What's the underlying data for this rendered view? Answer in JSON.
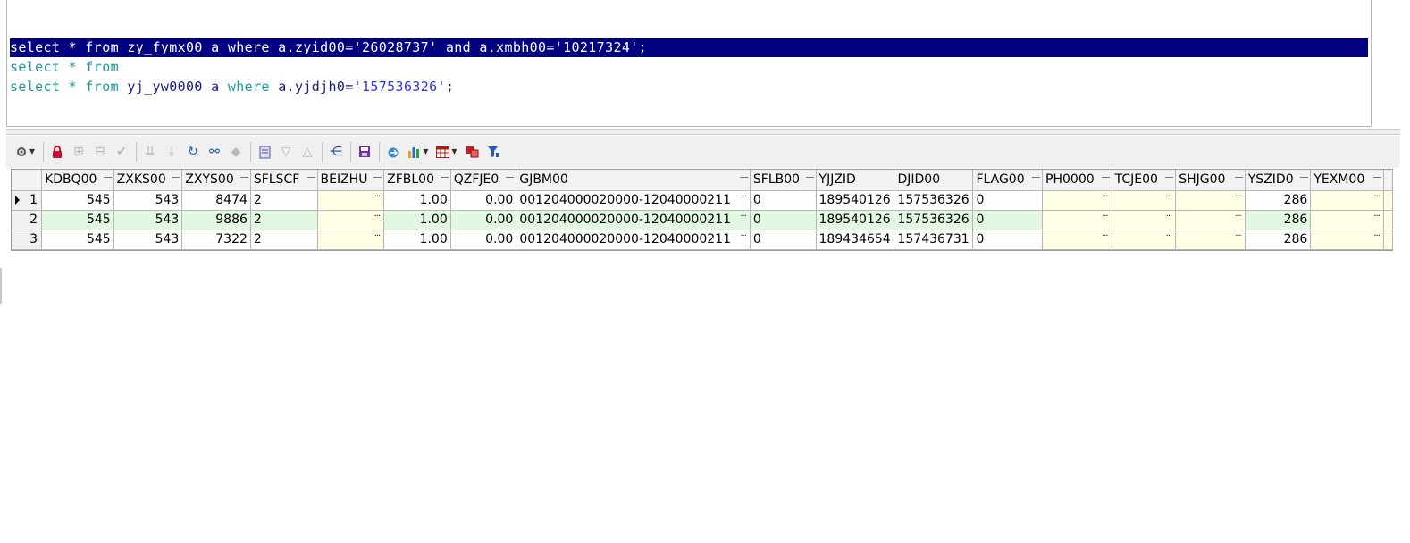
{
  "editor": {
    "lines": [
      {
        "t1": "select * from zy_fymx00 a where a.zyid00=",
        "t2": "'26028737'",
        "t3": " and a.xmbh00=",
        "t4": "'10217324'",
        "t5": ";"
      },
      {
        "kw": "select * from"
      },
      {
        "kw1": "select * from ",
        "id1": "yj_yw0000 a ",
        "kw2": "where ",
        "id2": "a.yjdjh0=",
        "str": "'157536326'",
        "end": ";"
      }
    ]
  },
  "toolbar": {
    "icons": [
      "options-icon",
      "lock-icon",
      "insert-record-icon",
      "delete-record-icon",
      "post-changes-icon",
      "next-record-icon",
      "last-record-icon",
      "refresh-icon",
      "find-icon",
      "clear-icon",
      "single-record-view-icon",
      "query-by-example-icon",
      "clear-query-icon",
      "explain-plan-icon",
      "save-icon",
      "export-icon",
      "chart-icon",
      "table-view-icon",
      "compare-icon",
      "filter-icon"
    ]
  },
  "grid": {
    "columns": [
      "KDBQ00",
      "ZXKS00",
      "ZXYS00",
      "SFLSCF",
      "BEIZHU",
      "ZFBL00",
      "QZFJE0",
      "GJBM00",
      "SFLB00",
      "YJJZID",
      "DJID00",
      "FLAG00",
      "PH0000",
      "TCJE00",
      "SHJG00",
      "YSZID0",
      "YEXM00",
      ""
    ],
    "rows": [
      {
        "n": "1",
        "KDBQ00": "545",
        "ZXKS00": "543",
        "ZXYS00": "8474",
        "SFLSCF": "2",
        "BEIZHU": "",
        "ZFBL00": "1.00",
        "QZFJE0": "0.00",
        "GJBM00": "001204000020000-12040000211",
        "SFLB00": "0",
        "YJJZID": "189540126",
        "DJID00": "157536326",
        "FLAG00": "0",
        "PH0000": "",
        "TCJE00": "",
        "SHJG00": "",
        "YSZID0": "286",
        "YEXM00": ""
      },
      {
        "n": "2",
        "KDBQ00": "545",
        "ZXKS00": "543",
        "ZXYS00": "9886",
        "SFLSCF": "2",
        "BEIZHU": "",
        "ZFBL00": "1.00",
        "QZFJE0": "0.00",
        "GJBM00": "001204000020000-12040000211",
        "SFLB00": "0",
        "YJJZID": "189540126",
        "DJID00": "157536326",
        "FLAG00": "0",
        "PH0000": "",
        "TCJE00": "",
        "SHJG00": "",
        "YSZID0": "286",
        "YEXM00": ""
      },
      {
        "n": "3",
        "KDBQ00": "545",
        "ZXKS00": "543",
        "ZXYS00": "7322",
        "SFLSCF": "2",
        "BEIZHU": "",
        "ZFBL00": "1.00",
        "QZFJE0": "0.00",
        "GJBM00": "001204000020000-12040000211",
        "SFLB00": "0",
        "YJJZID": "189434654",
        "DJID00": "157436731",
        "FLAG00": "0",
        "PH0000": "",
        "TCJE00": "",
        "SHJG00": "",
        "YSZID0": "286",
        "YEXM00": ""
      }
    ],
    "ellipsis": "..."
  }
}
